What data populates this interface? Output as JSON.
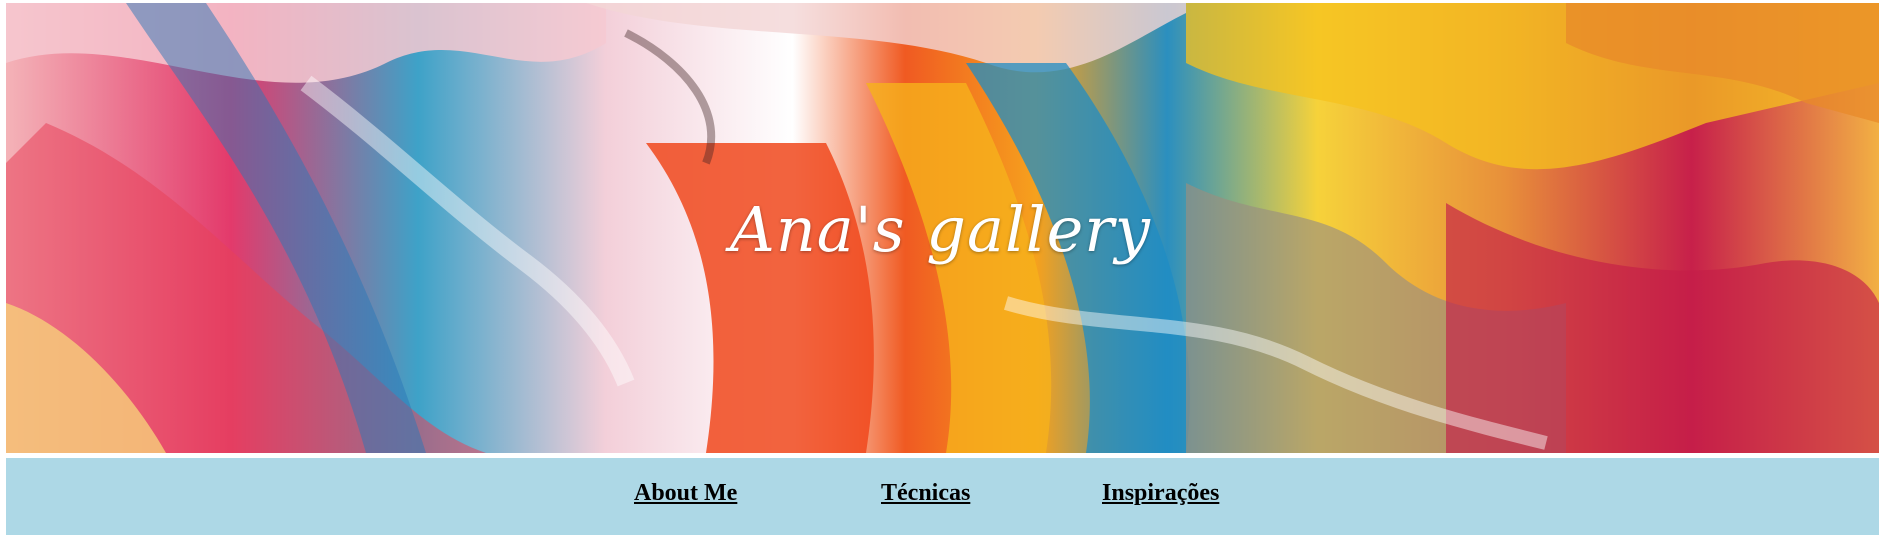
{
  "header": {
    "title": "Ana's gallery",
    "background": "abstract-paint-strokes-image"
  },
  "nav": {
    "items": [
      {
        "label": "About Me"
      },
      {
        "label": "Técnicas"
      },
      {
        "label": "Inspirações"
      }
    ],
    "background_color": "#add8e6"
  }
}
